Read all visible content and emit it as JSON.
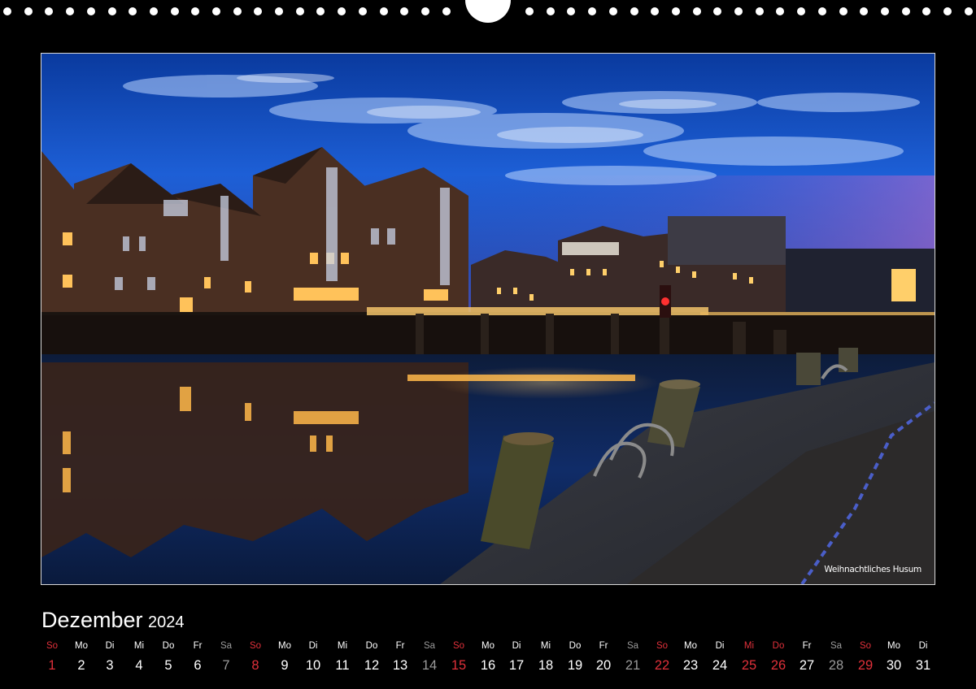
{
  "photo": {
    "caption": "Weihnachtliches Husum",
    "subject": "Husum harbour at dusk"
  },
  "calendar": {
    "month": "Dezember",
    "year": "2024",
    "days": [
      {
        "wd": "So",
        "n": "1",
        "type": "sun"
      },
      {
        "wd": "Mo",
        "n": "2",
        "type": "work"
      },
      {
        "wd": "Di",
        "n": "3",
        "type": "work"
      },
      {
        "wd": "Mi",
        "n": "4",
        "type": "work"
      },
      {
        "wd": "Do",
        "n": "5",
        "type": "work"
      },
      {
        "wd": "Fr",
        "n": "6",
        "type": "work"
      },
      {
        "wd": "Sa",
        "n": "7",
        "type": "sat"
      },
      {
        "wd": "So",
        "n": "8",
        "type": "sun"
      },
      {
        "wd": "Mo",
        "n": "9",
        "type": "work"
      },
      {
        "wd": "Di",
        "n": "10",
        "type": "work"
      },
      {
        "wd": "Mi",
        "n": "11",
        "type": "work"
      },
      {
        "wd": "Do",
        "n": "12",
        "type": "work"
      },
      {
        "wd": "Fr",
        "n": "13",
        "type": "work"
      },
      {
        "wd": "Sa",
        "n": "14",
        "type": "sat"
      },
      {
        "wd": "So",
        "n": "15",
        "type": "sun"
      },
      {
        "wd": "Mo",
        "n": "16",
        "type": "work"
      },
      {
        "wd": "Di",
        "n": "17",
        "type": "work"
      },
      {
        "wd": "Mi",
        "n": "18",
        "type": "work"
      },
      {
        "wd": "Do",
        "n": "19",
        "type": "work"
      },
      {
        "wd": "Fr",
        "n": "20",
        "type": "work"
      },
      {
        "wd": "Sa",
        "n": "21",
        "type": "sat"
      },
      {
        "wd": "So",
        "n": "22",
        "type": "sun"
      },
      {
        "wd": "Mo",
        "n": "23",
        "type": "work"
      },
      {
        "wd": "Di",
        "n": "24",
        "type": "work"
      },
      {
        "wd": "Mi",
        "n": "25",
        "type": "hol"
      },
      {
        "wd": "Do",
        "n": "26",
        "type": "hol"
      },
      {
        "wd": "Fr",
        "n": "27",
        "type": "work"
      },
      {
        "wd": "Sa",
        "n": "28",
        "type": "sat"
      },
      {
        "wd": "So",
        "n": "29",
        "type": "sun"
      },
      {
        "wd": "Mo",
        "n": "30",
        "type": "work"
      },
      {
        "wd": "Di",
        "n": "31",
        "type": "work"
      }
    ]
  },
  "colors": {
    "background": "#000000",
    "sunday_holiday": "#e0303a",
    "saturday": "#9a9a9a",
    "text": "#ffffff"
  }
}
